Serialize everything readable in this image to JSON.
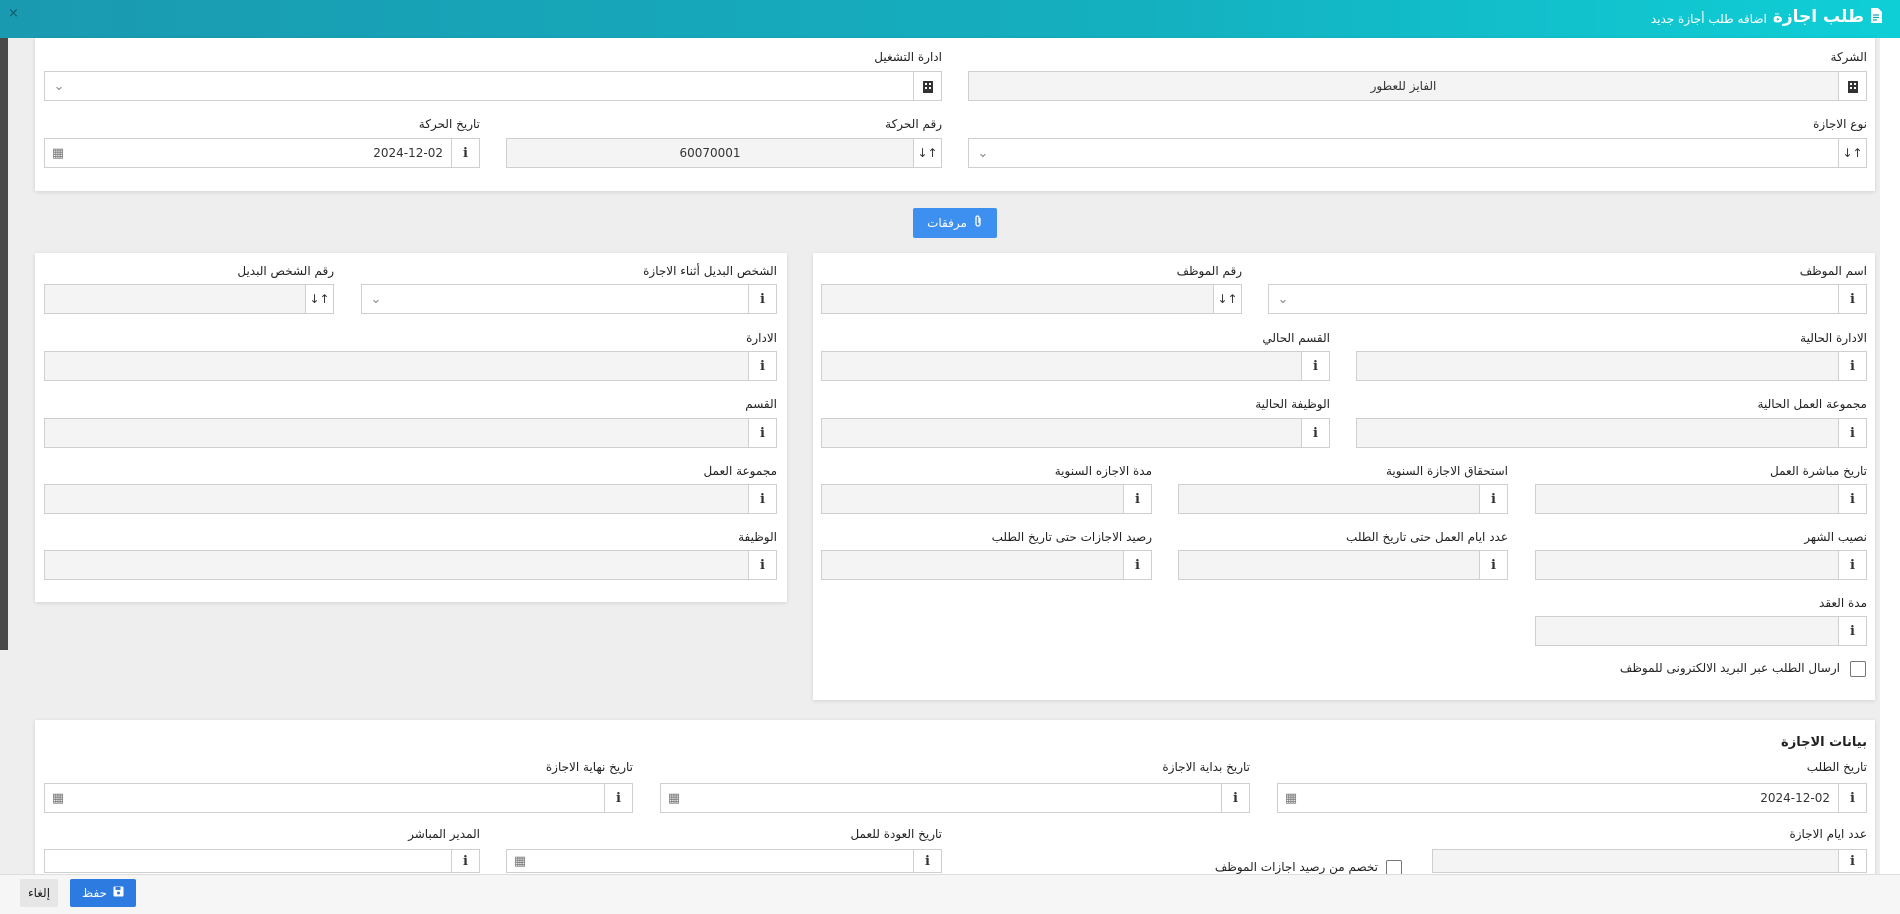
{
  "header": {
    "title": "طلب اجازة",
    "subtitle": "اضافه طلب أجازة جديد",
    "close": "×"
  },
  "top": {
    "company_label": "الشركة",
    "company_value": "الفايز للعطور",
    "operating_label": "ادارة التشغيل",
    "operating_value": "",
    "leave_type_label": "نوع الاجازة",
    "leave_type_value": "",
    "movement_no_label": "رقم الحركة",
    "movement_no_value": "60070001",
    "movement_date_label": "تاريخ الحركة",
    "movement_date_value": "2024-12-02"
  },
  "attachments_label": "مرفقات",
  "employee": {
    "name_label": "اسم الموظف",
    "number_label": "رقم الموظف",
    "current_dept_label": "الادارة الحالية",
    "current_section_label": "القسم الحالي",
    "current_group_label": "مجموعة العمل الحالية",
    "current_job_label": "الوظيفة الحالية",
    "start_date_label": "تاريخ مباشرة العمل",
    "annual_entitlement_label": "استحقاق الاجازة السنوية",
    "annual_duration_label": "مدة الاجازه السنوية",
    "month_share_label": "نصيب الشهر",
    "workdays_label": "عدد ايام العمل حتى تاريخ الطلب",
    "balance_label": "رصيد الاجازات حتى تاريخ الطلب",
    "contract_label": "مدة العقد",
    "email_label": "ارسال الطلب عبر البريد الالكترونى للموظف"
  },
  "substitute": {
    "person_label": "الشخص البديل أثناء الاجازة",
    "number_label": "رقم الشخص البديل",
    "dept_label": "الادارة",
    "section_label": "القسم",
    "group_label": "مجموعة العمل",
    "job_label": "الوظيفة"
  },
  "leave": {
    "section_title": "بيانات الاجازة",
    "request_date_label": "تاريخ الطلب",
    "request_date_value": "2024-12-02",
    "start_label": "تاريخ بداية الاجازة",
    "end_label": "تاريخ نهاية الاجازة",
    "days_label": "عدد ايام الاجازة",
    "deduct_label": "تخصم من رصيد اجازات الموظف",
    "return_label": "تاريخ العودة للعمل",
    "manager_label": "المدير المباشر"
  },
  "footer": {
    "save": "حفظ",
    "cancel": "إلغاء"
  },
  "colors": {
    "header_start": "#1a9ab1",
    "header_end": "#0fcfd6",
    "primary_button": "#2d7be0",
    "attach_button": "#3d8ff0"
  }
}
